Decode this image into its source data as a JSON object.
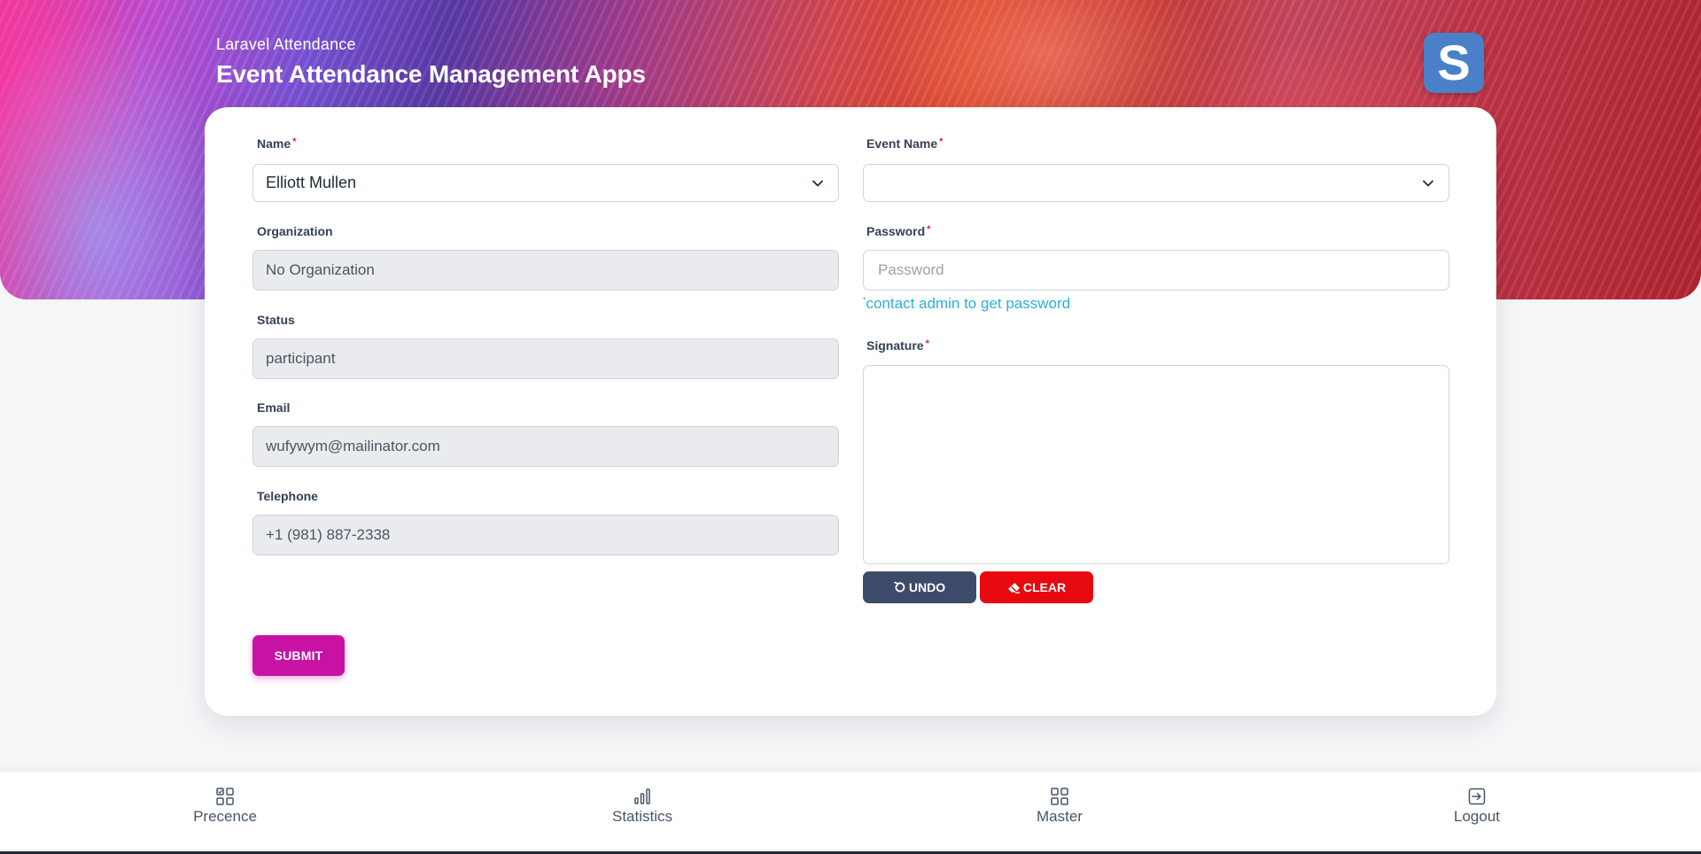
{
  "header": {
    "subtitle": "Laravel Attendance",
    "title": "Event Attendance Management Apps",
    "logo_letter": "S",
    "logo_color": "#4a80c8"
  },
  "form": {
    "name": {
      "label": "Name",
      "required_mark": "*",
      "value": "Elliott Mullen"
    },
    "organization": {
      "label": "Organization",
      "value": "No Organization"
    },
    "status": {
      "label": "Status",
      "value": "participant"
    },
    "email": {
      "label": "Email",
      "value": "wufywym@mailinator.com"
    },
    "telephone": {
      "label": "Telephone",
      "value": "+1 (981) 887-2338"
    },
    "event_name": {
      "label": "Event Name",
      "required_mark": "*",
      "value": ""
    },
    "password": {
      "label": "Password",
      "required_mark": "*",
      "placeholder": "Password",
      "hint_mark": "*",
      "hint": "contact admin to get password"
    },
    "signature": {
      "label": "Signature",
      "required_mark": "*"
    },
    "undo_label": "UNDO",
    "clear_label": "CLEAR",
    "submit_label": "SUBMIT"
  },
  "colors": {
    "submit": "#c812a4",
    "undo": "#3d4b6b",
    "clear": "#e8080f",
    "hint": "#2bb0d6"
  },
  "nav": {
    "items": [
      {
        "label": "Precence",
        "icon": "grid-check-icon"
      },
      {
        "label": "Statistics",
        "icon": "bar-chart-icon"
      },
      {
        "label": "Master",
        "icon": "grid-icon"
      },
      {
        "label": "Logout",
        "icon": "logout-icon"
      }
    ]
  }
}
